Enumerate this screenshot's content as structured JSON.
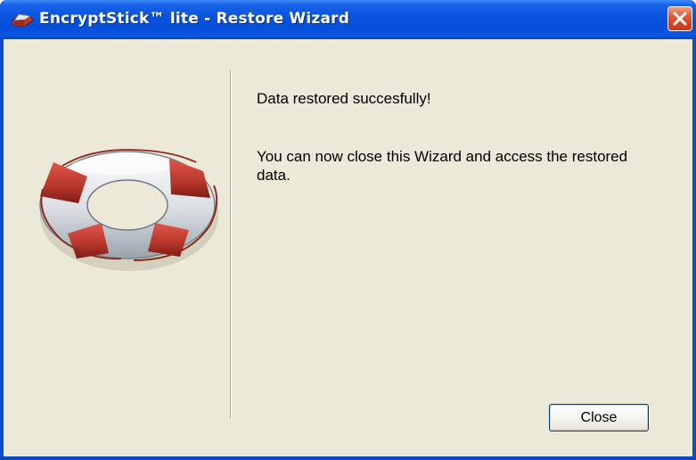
{
  "window": {
    "title": "EncryptStick™ lite - Restore Wizard",
    "app_icon": "encryptstick-app-icon",
    "close_icon": "close-icon"
  },
  "content": {
    "illustration": "lifebuoy-icon",
    "message_line1": "Data restored succesfully!",
    "message_line2": "You can now close this Wizard and access the restored data."
  },
  "footer": {
    "close_label": "Close"
  },
  "colors": {
    "titlebar": "#0a54e0",
    "client_background": "#ece9d8",
    "close_button": "#d5421f",
    "lifebuoy_red": "#b8392c",
    "lifebuoy_white": "#eef0f2"
  }
}
